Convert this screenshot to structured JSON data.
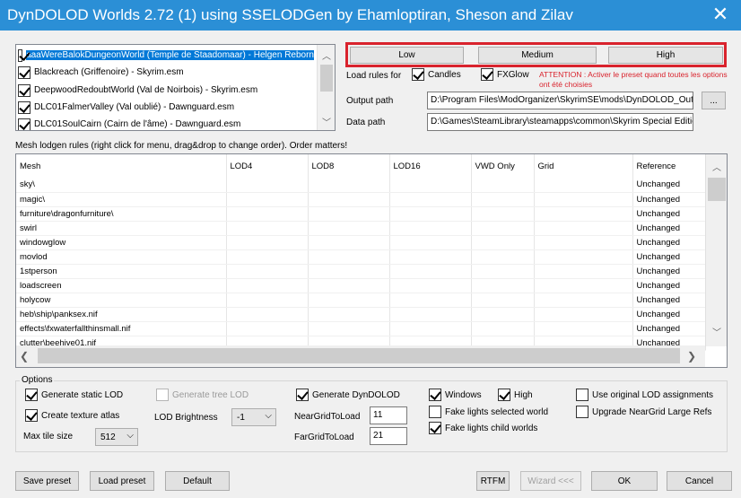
{
  "window": {
    "title": "DynDOLOD Worlds 2.72 (1) using SSELODGen by Ehamloptiran, Sheson and Zilav",
    "close_label": "✕"
  },
  "worlds": [
    {
      "label": "aaaWereBalokDungeonWorld (Temple de Staadomaar) - Helgen Reborn",
      "checked": true,
      "selected": true
    },
    {
      "label": "Blackreach (Griffenoire) - Skyrim.esm",
      "checked": true,
      "selected": false
    },
    {
      "label": "DeepwoodRedoubtWorld (Val de Noirbois) - Skyrim.esm",
      "checked": true,
      "selected": false
    },
    {
      "label": "DLC01FalmerValley (Val oublié) - Dawnguard.esm",
      "checked": true,
      "selected": false
    },
    {
      "label": "DLC01SoulCairn (Cairn de l'âme) - Dawnguard.esm",
      "checked": true,
      "selected": false
    }
  ],
  "presets": {
    "low": "Low",
    "medium": "Medium",
    "high": "High",
    "highlight_color": "#d9232d"
  },
  "load_rules": {
    "label": "Load rules for",
    "candles": "Candles",
    "fxglow": "FXGlow"
  },
  "attention": {
    "line1": "ATTENTION : Activer le preset quand toutes les options",
    "line2": "ont été choisies",
    "color": "#d9232d"
  },
  "paths": {
    "output_label": "Output path",
    "output_value": "D:\\Program Files\\ModOrganizer\\SkyrimSE\\mods\\DynDOLOD_Output",
    "browse_label": "...",
    "data_label": "Data path",
    "data_value": "D:\\Games\\SteamLibrary\\steamapps\\common\\Skyrim Special Edition\\Data"
  },
  "mesh_rules": {
    "caption": "Mesh lodgen rules (right click for menu, drag&drop to change order). Order matters!",
    "columns": [
      "Mesh",
      "LOD4",
      "LOD8",
      "LOD16",
      "VWD Only",
      "Grid",
      "Reference"
    ],
    "rows": [
      {
        "mesh": "sky\\",
        "reference": "Unchanged"
      },
      {
        "mesh": "magic\\",
        "reference": "Unchanged"
      },
      {
        "mesh": "furniture\\dragonfurniture\\",
        "reference": "Unchanged"
      },
      {
        "mesh": "swirl",
        "reference": "Unchanged"
      },
      {
        "mesh": "windowglow",
        "reference": "Unchanged"
      },
      {
        "mesh": "movlod",
        "reference": "Unchanged"
      },
      {
        "mesh": "1stperson",
        "reference": "Unchanged"
      },
      {
        "mesh": "loadscreen",
        "reference": "Unchanged"
      },
      {
        "mesh": "holycow",
        "reference": "Unchanged"
      },
      {
        "mesh": "heb\\ship\\panksex.nif",
        "reference": "Unchanged"
      },
      {
        "mesh": "effects\\fxwaterfallthinsmall.nif",
        "reference": "Unchanged"
      },
      {
        "mesh": "clutter\\beehive01.nif",
        "reference": "Unchanged"
      }
    ]
  },
  "options": {
    "legend": "Options",
    "generate_static_lod": "Generate static LOD",
    "create_texture_atlas": "Create texture atlas",
    "max_tile_size_label": "Max tile size",
    "max_tile_size_value": "512",
    "generate_tree_lod": "Generate tree LOD",
    "lod_brightness_label": "LOD Brightness",
    "lod_brightness_value": "-1",
    "generate_dyndolod": "Generate DynDOLOD",
    "near_grid_label": "NearGridToLoad",
    "near_grid_value": "11",
    "far_grid_label": "FarGridToLoad",
    "far_grid_value": "21",
    "windows": "Windows",
    "high": "High",
    "fake_lights_selected": "Fake lights selected world",
    "fake_lights_child": "Fake lights child worlds",
    "use_original_lod": "Use original LOD assignments",
    "upgrade_neargrid": "Upgrade NearGrid Large Refs"
  },
  "footer": {
    "save_preset": "Save preset",
    "load_preset": "Load preset",
    "default": "Default",
    "rtfm": "RTFM",
    "wizard": "Wizard <<<",
    "ok": "OK",
    "cancel": "Cancel"
  }
}
